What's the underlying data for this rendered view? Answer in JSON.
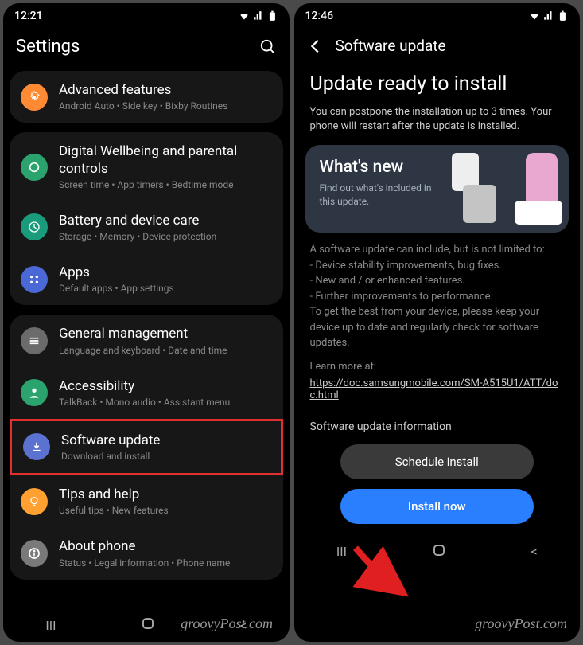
{
  "left": {
    "statusbar": {
      "time": "12:21"
    },
    "header": {
      "title": "Settings"
    },
    "groups": [
      {
        "items": [
          {
            "title": "Advanced features",
            "sub": "Android Auto  •  Side key  •  Bixby Routines",
            "color": "#ff8a34",
            "icon": "gear"
          }
        ]
      },
      {
        "items": [
          {
            "title": "Digital Wellbeing and parental controls",
            "sub": "Screen time  •  App timers  •  Bedtime mode",
            "color": "#2aa36e",
            "icon": "circle"
          },
          {
            "title": "Battery and device care",
            "sub": "Storage  •  Memory  •  Device protection",
            "color": "#1a9b7b",
            "icon": "battery"
          },
          {
            "title": "Apps",
            "sub": "Default apps  •  App settings",
            "color": "#4a68d6",
            "icon": "grid"
          }
        ]
      },
      {
        "items": [
          {
            "title": "General management",
            "sub": "Language and keyboard  •  Date and time",
            "color": "#6b6b6b",
            "icon": "bars"
          },
          {
            "title": "Accessibility",
            "sub": "TalkBack  •  Mono audio  •  Assistant menu",
            "color": "#2aa36e",
            "icon": "person"
          },
          {
            "title": "Software update",
            "sub": "Download and install",
            "color": "#5b72d1",
            "icon": "download",
            "highlight": true
          },
          {
            "title": "Tips and help",
            "sub": "Useful tips  •  New features",
            "color": "#ffa030",
            "icon": "bulb"
          },
          {
            "title": "About phone",
            "sub": "Status  •  Legal information  •  Phone name",
            "color": "#7a7a7a",
            "icon": "info"
          }
        ]
      }
    ]
  },
  "right": {
    "statusbar": {
      "time": "12:46"
    },
    "header": {
      "title": "Software update"
    },
    "big_title": "Update ready to install",
    "desc": "You can postpone the installation up to 3 times. Your phone will restart after the update is installed.",
    "whatsnew": {
      "title": "What's new",
      "sub": "Find out what's included in this update."
    },
    "info_lines": [
      "A software update can include, but is not limited to:",
      " - Device stability improvements, bug fixes.",
      " - New and / or enhanced features.",
      " - Further improvements to performance.",
      "To get the best from your device, please keep your device up to date and regularly check for software updates."
    ],
    "learn": "Learn more at:",
    "link": "https://doc.samsungmobile.com/SM-A515U1/ATT/doc.html",
    "more_info": "Software update information",
    "buttons": {
      "schedule": "Schedule install",
      "install": "Install now"
    }
  },
  "watermark": "groovyPost.com"
}
